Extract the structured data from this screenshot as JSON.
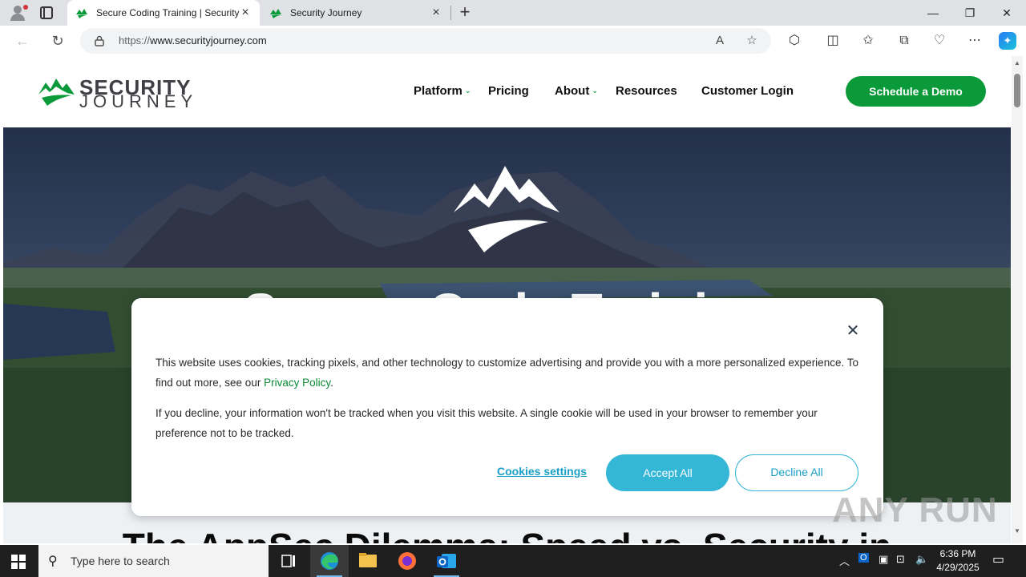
{
  "browser": {
    "tabs": [
      {
        "title": "Secure Coding Training | Security",
        "active": true
      },
      {
        "title": "Security Journey",
        "active": false
      }
    ],
    "url_protocol": "https://",
    "url_host": "www.securityjourney.com",
    "window_controls": {
      "minimize": "—",
      "restore": "❐",
      "close": "✕"
    }
  },
  "site": {
    "logo_word1": "SECURITY",
    "logo_word2": "JOURNEY",
    "nav": [
      {
        "label": "Platform",
        "has_dropdown": true
      },
      {
        "label": "Pricing",
        "has_dropdown": false
      },
      {
        "label": "About",
        "has_dropdown": true
      },
      {
        "label": "Resources",
        "has_dropdown": false
      },
      {
        "label": "Customer Login",
        "has_dropdown": false
      }
    ],
    "cta": "Schedule a Demo",
    "brand_color": "#0b9a3a"
  },
  "hero": {
    "title": "Secure Code Training"
  },
  "section": {
    "title": "The AppSec Dilemma: Speed vs. Security in"
  },
  "cookie_banner": {
    "text1_before": "This website uses cookies, tracking pixels, and other technology to customize advertising and provide you with a more personalized experience. To find out more, see our ",
    "privacy_link": "Privacy Policy",
    "text1_after": ".",
    "text2": "If you decline, your information won't be tracked when you visit this website. A single cookie will be used in your browser to remember your preference not to be tracked.",
    "settings_label": "Cookies settings",
    "accept_label": "Accept All",
    "decline_label": "Decline All",
    "accent_color": "#34b6d6"
  },
  "watermark": "ANY RUN",
  "taskbar": {
    "search_placeholder": "Type here to search",
    "time": "6:36 PM",
    "date": "4/29/2025"
  }
}
